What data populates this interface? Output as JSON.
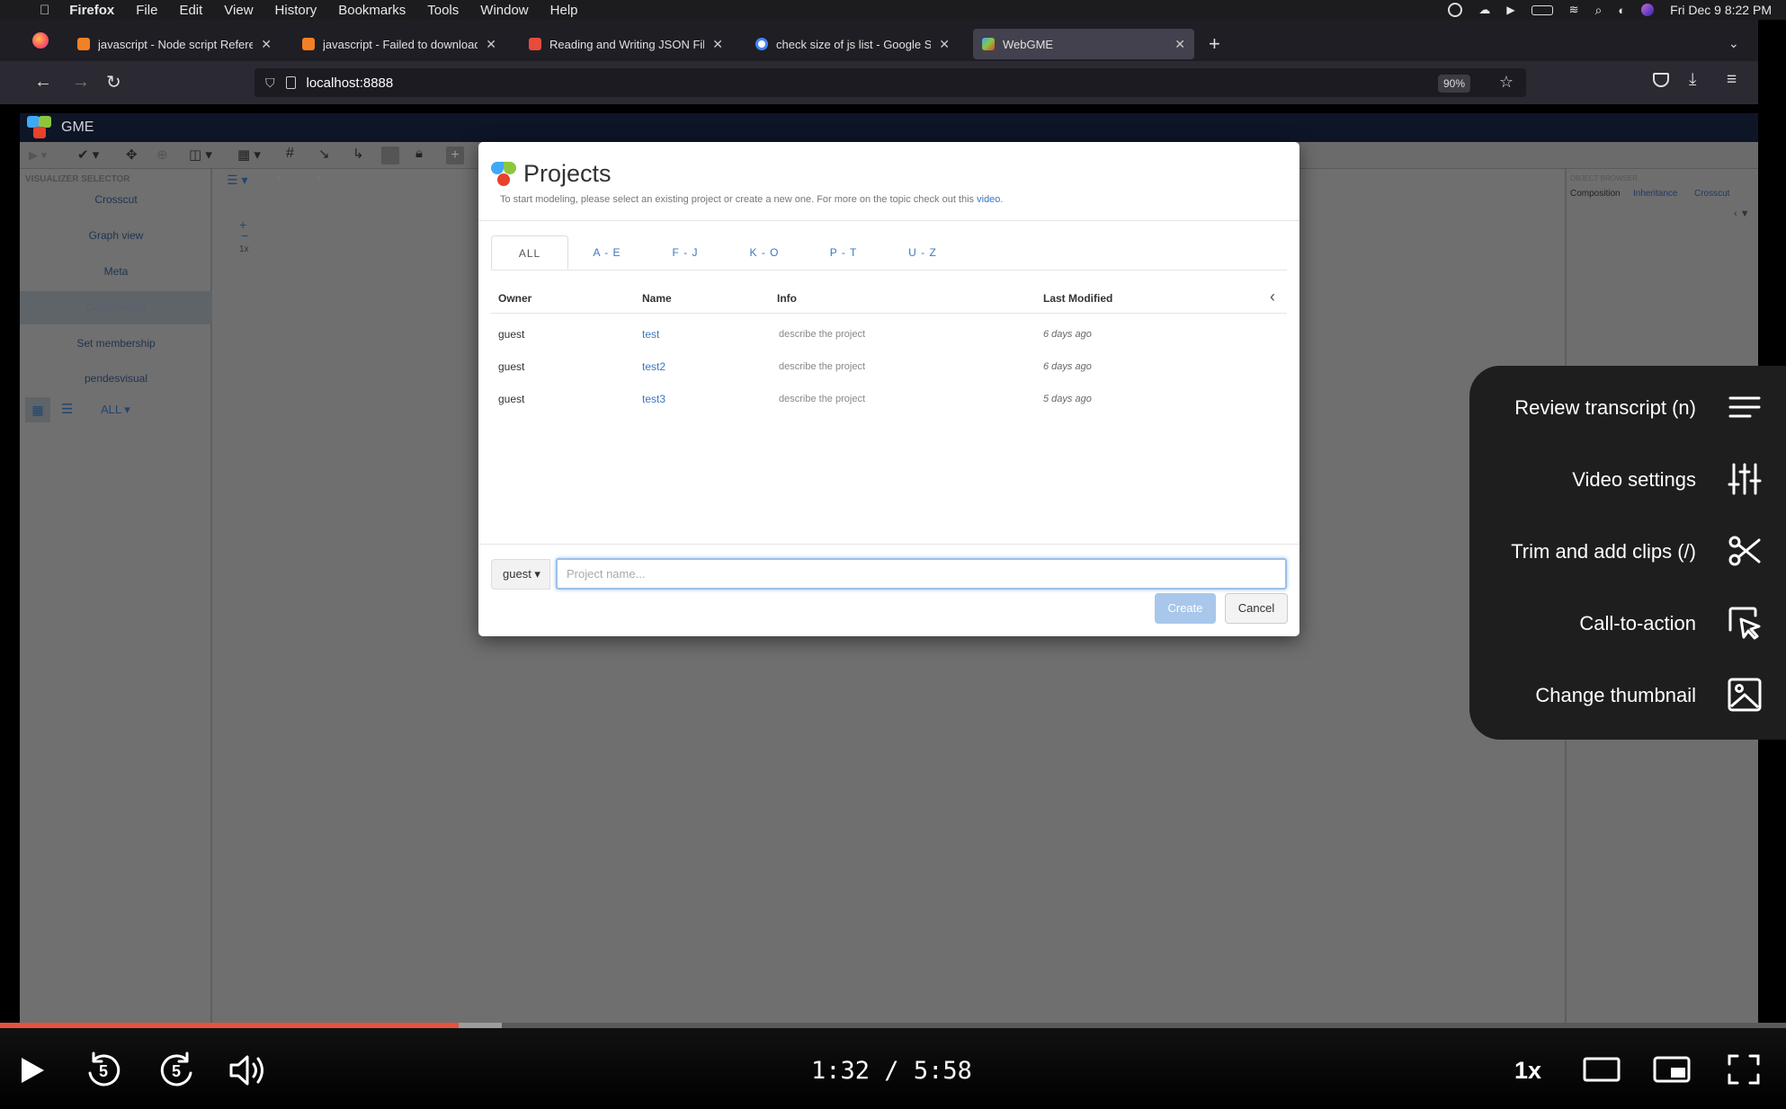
{
  "menubar": {
    "app": "Firefox",
    "items": [
      "File",
      "Edit",
      "View",
      "History",
      "Bookmarks",
      "Tools",
      "Window",
      "Help"
    ],
    "clock": "Fri Dec 9  8:22 PM"
  },
  "tabs": [
    {
      "title": "javascript - Node script Referen",
      "favicon_color": "#f48024"
    },
    {
      "title": "javascript - Failed to download a",
      "favicon_color": "#f48024"
    },
    {
      "title": "Reading and Writing JSON Files",
      "favicon_color": "#e74c3c"
    },
    {
      "title": "check size of js list - Google Se",
      "favicon_color": "#4285f4"
    },
    {
      "title": "WebGME",
      "favicon_color": "#3fa9f5",
      "active": true
    }
  ],
  "nav": {
    "url": "localhost:8888",
    "zoom": "90%"
  },
  "gme": {
    "brand": "GME",
    "visualizer_title": "VISUALIZER SELECTOR",
    "visualizers": [
      "Crosscut",
      "Graph view",
      "Meta",
      "Composition",
      "Set membership",
      "pendesvisual"
    ],
    "selected_visualizer": "Composition",
    "filter_label": "ALL",
    "zoom_level": "1x",
    "object_browser_title": "OBJECT BROWSER",
    "object_browser_tabs": [
      "Composition",
      "Inheritance",
      "Crosscut"
    ]
  },
  "modal": {
    "title": "Projects",
    "subtitle": "To start modeling, please select an existing project or create a new one. For more on the topic check out this",
    "subtitle_link": "video",
    "subtitle_end": ".",
    "tabs": [
      "ALL",
      "A - E",
      "F - J",
      "K - O",
      "P - T",
      "U - Z"
    ],
    "active_tab": "ALL",
    "columns": [
      "Owner",
      "Name",
      "Info",
      "Last Modified"
    ],
    "rows": [
      {
        "owner": "guest",
        "name": "test",
        "info": "describe the project",
        "modified": "6 days ago"
      },
      {
        "owner": "guest",
        "name": "test2",
        "info": "describe the project",
        "modified": "6 days ago"
      },
      {
        "owner": "guest",
        "name": "test3",
        "info": "describe the project",
        "modified": "5 days ago"
      }
    ],
    "owner_select": "guest",
    "project_name_placeholder": "Project name...",
    "create_label": "Create",
    "cancel_label": "Cancel"
  },
  "video_menu": {
    "items": [
      {
        "label": "Review transcript (n)",
        "icon": "lines-icon"
      },
      {
        "label": "Video settings",
        "icon": "sliders-icon"
      },
      {
        "label": "Trim and add clips (/)",
        "icon": "scissors-icon"
      },
      {
        "label": "Call-to-action",
        "icon": "cursor-click-icon"
      },
      {
        "label": "Change thumbnail",
        "icon": "image-icon"
      }
    ]
  },
  "player": {
    "current_time": "1:32",
    "separator": "/",
    "duration": "5:58",
    "progress_fraction": 0.257,
    "buffered_fraction": 0.281,
    "speed": "1x",
    "skip_back_seconds": "5",
    "skip_forward_seconds": "5",
    "progress_color": "#e5533d"
  }
}
